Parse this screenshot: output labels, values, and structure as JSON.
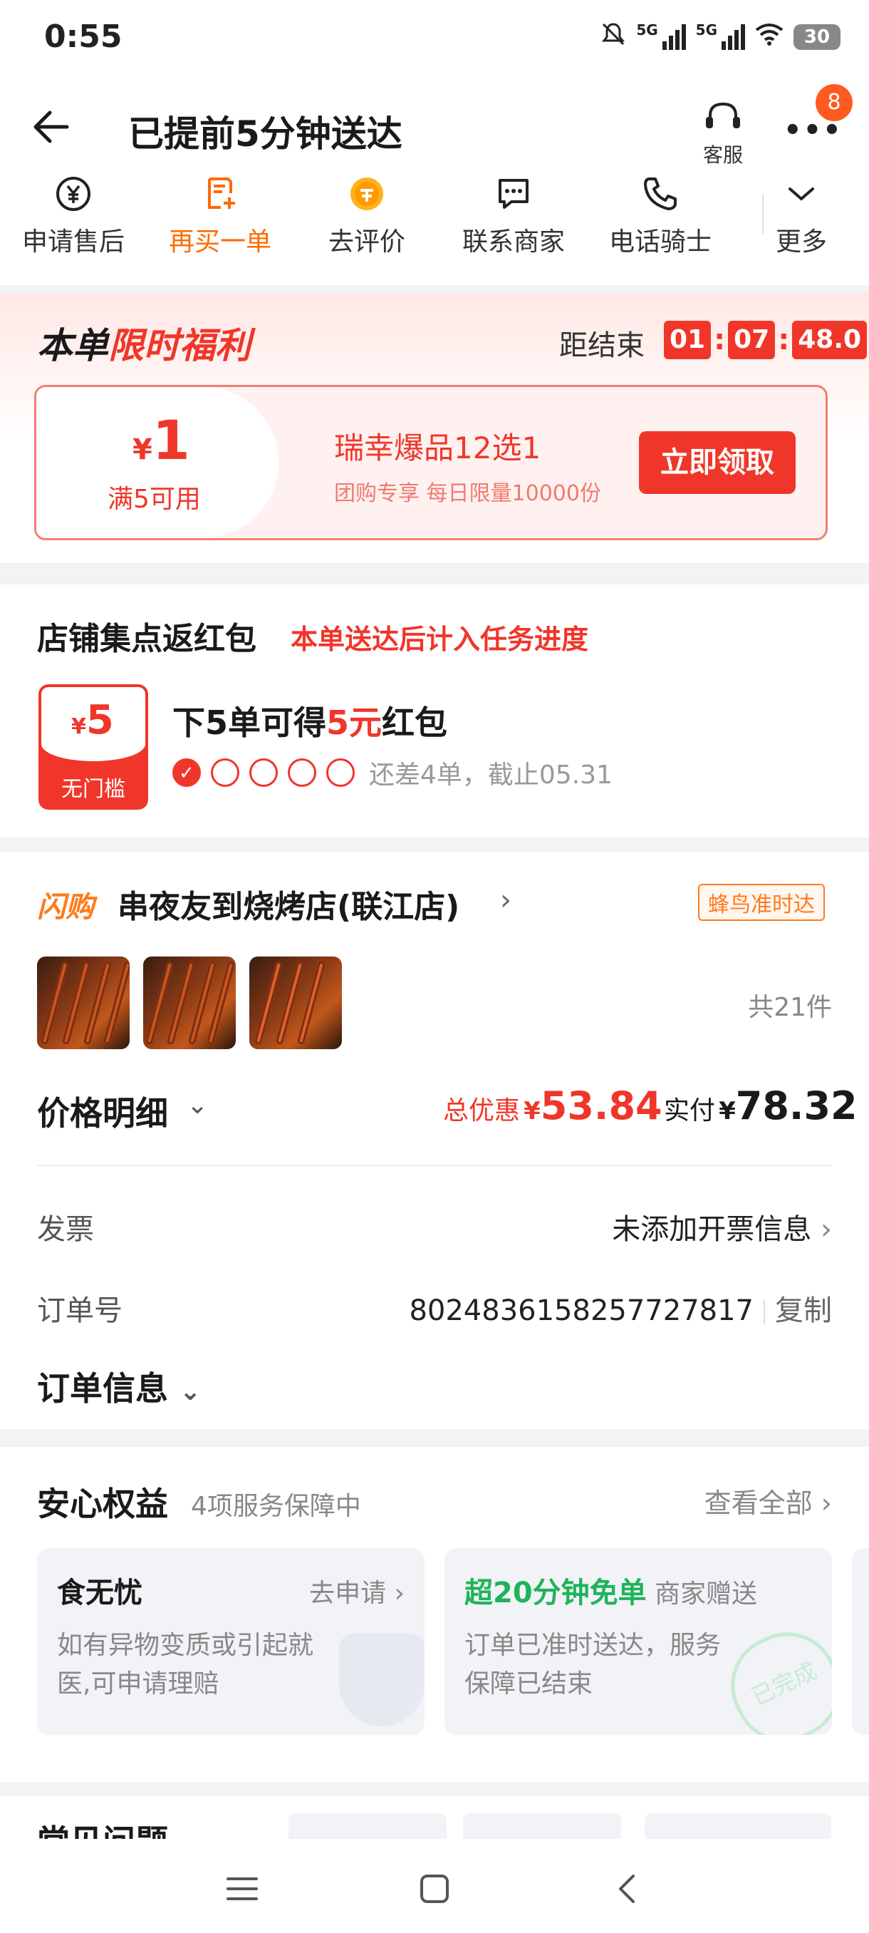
{
  "status_bar": {
    "time": "0:55",
    "battery": "30",
    "network1": "5G",
    "network2": "5G"
  },
  "header": {
    "title": "已提前5分钟送达",
    "service_label": "客服",
    "badge": "8"
  },
  "actions": [
    {
      "label": "申请售后",
      "icon": "yuan-refresh-icon"
    },
    {
      "label": "再买一单",
      "icon": "reorder-icon"
    },
    {
      "label": "去评价",
      "icon": "coin-review-icon"
    },
    {
      "label": "联系商家",
      "icon": "chat-icon"
    },
    {
      "label": "电话骑士",
      "icon": "phone-icon"
    },
    {
      "label": "更多",
      "icon": "chevron-down-icon"
    }
  ],
  "promo": {
    "title_a": "本单",
    "title_b": "限时福利",
    "countdown_label": "距结束",
    "countdown": {
      "h": "01",
      "m": "07",
      "s": "48.0"
    },
    "coupon": {
      "currency": "¥",
      "amount": "1",
      "condition": "满5可用",
      "name": "瑞幸爆品12选1",
      "sub": "团购专享 每日限量10000份",
      "button": "立即领取"
    }
  },
  "points": {
    "title": "店铺集点返红包",
    "title_hl": "本单送达后计入任务进度",
    "redpack_currency": "¥",
    "redpack_amount": "5",
    "redpack_label": "无门槛",
    "goal_a": "下5单可得",
    "goal_b": "5元",
    "goal_c": "红包",
    "progress_done": 1,
    "progress_total": 5,
    "progress_text": "还差4单，截止05.31"
  },
  "shop": {
    "flash_tag": "闪购",
    "name": "串夜友到烧烤店(联江店)",
    "ontime_badge": "蜂鸟准时达",
    "item_count": "共21件",
    "price_label": "价格明细",
    "discount_label": "总优惠",
    "discount_currency": "¥",
    "discount_value": "53.84",
    "paid_label": "实付",
    "paid_currency": "¥",
    "paid_value": "78.32",
    "invoice_label": "发票",
    "invoice_value": "未添加开票信息",
    "order_no_label": "订单号",
    "order_no": "8024836158257727817",
    "copy": "复制",
    "order_info": "订单信息"
  },
  "rights": {
    "title": "安心权益",
    "sub": "4项服务保障中",
    "view_all": "查看全部",
    "cards": [
      {
        "title": "食无忧",
        "link": "去申请",
        "desc": "如有异物变质或引起就医,可申请理赔"
      },
      {
        "title_green": "超20分钟免单",
        "title_rest": "商家赠送",
        "desc": "订单已准时送达，服务保障已结束",
        "stamp": "已完成"
      }
    ]
  },
  "faq": {
    "title": "常见问题"
  }
}
